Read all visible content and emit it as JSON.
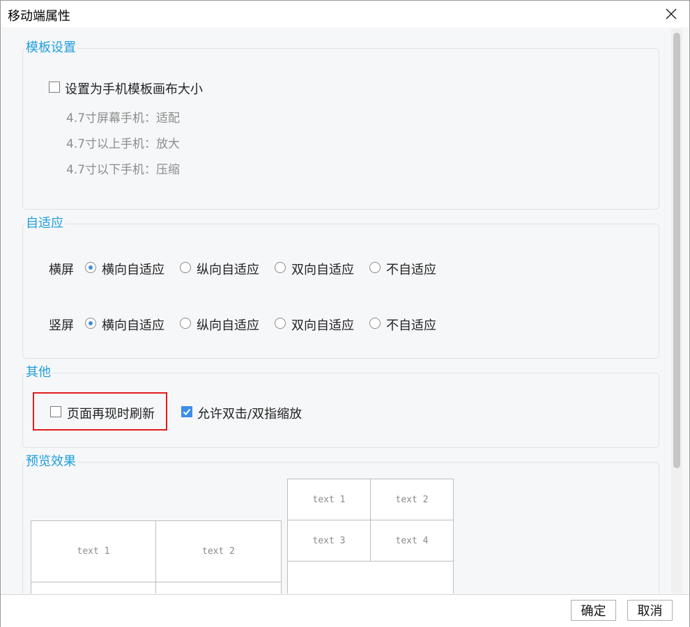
{
  "window": {
    "title": "移动端属性"
  },
  "template": {
    "legend": "模板设置",
    "checkbox_label": "设置为手机模板画布大小",
    "checked": false,
    "hints": [
      "4.7寸屏幕手机：适配",
      "4.7寸以上手机：放大",
      "4.7寸以下手机：压缩"
    ]
  },
  "adaptive": {
    "legend": "自适应",
    "rows": [
      {
        "label": "横屏",
        "options": [
          "横向自适应",
          "纵向自适应",
          "双向自适应",
          "不自适应"
        ],
        "selected": 0
      },
      {
        "label": "竖屏",
        "options": [
          "横向自适应",
          "纵向自适应",
          "双向自适应",
          "不自适应"
        ],
        "selected": 0
      }
    ]
  },
  "other": {
    "legend": "其他",
    "refresh_label": "页面再现时刷新",
    "refresh_checked": false,
    "zoom_label": "允许双击/双指缩放",
    "zoom_checked": true
  },
  "preview": {
    "legend": "预览效果",
    "left_cells": [
      "text 1",
      "text 2"
    ],
    "right_cells": [
      "text 1",
      "text 2",
      "text 3",
      "text 4"
    ]
  },
  "footer": {
    "ok": "确定",
    "cancel": "取消"
  },
  "colors": {
    "accent": "#1e9ede",
    "check": "#3d8ee6",
    "highlight": "#e21b1b"
  }
}
